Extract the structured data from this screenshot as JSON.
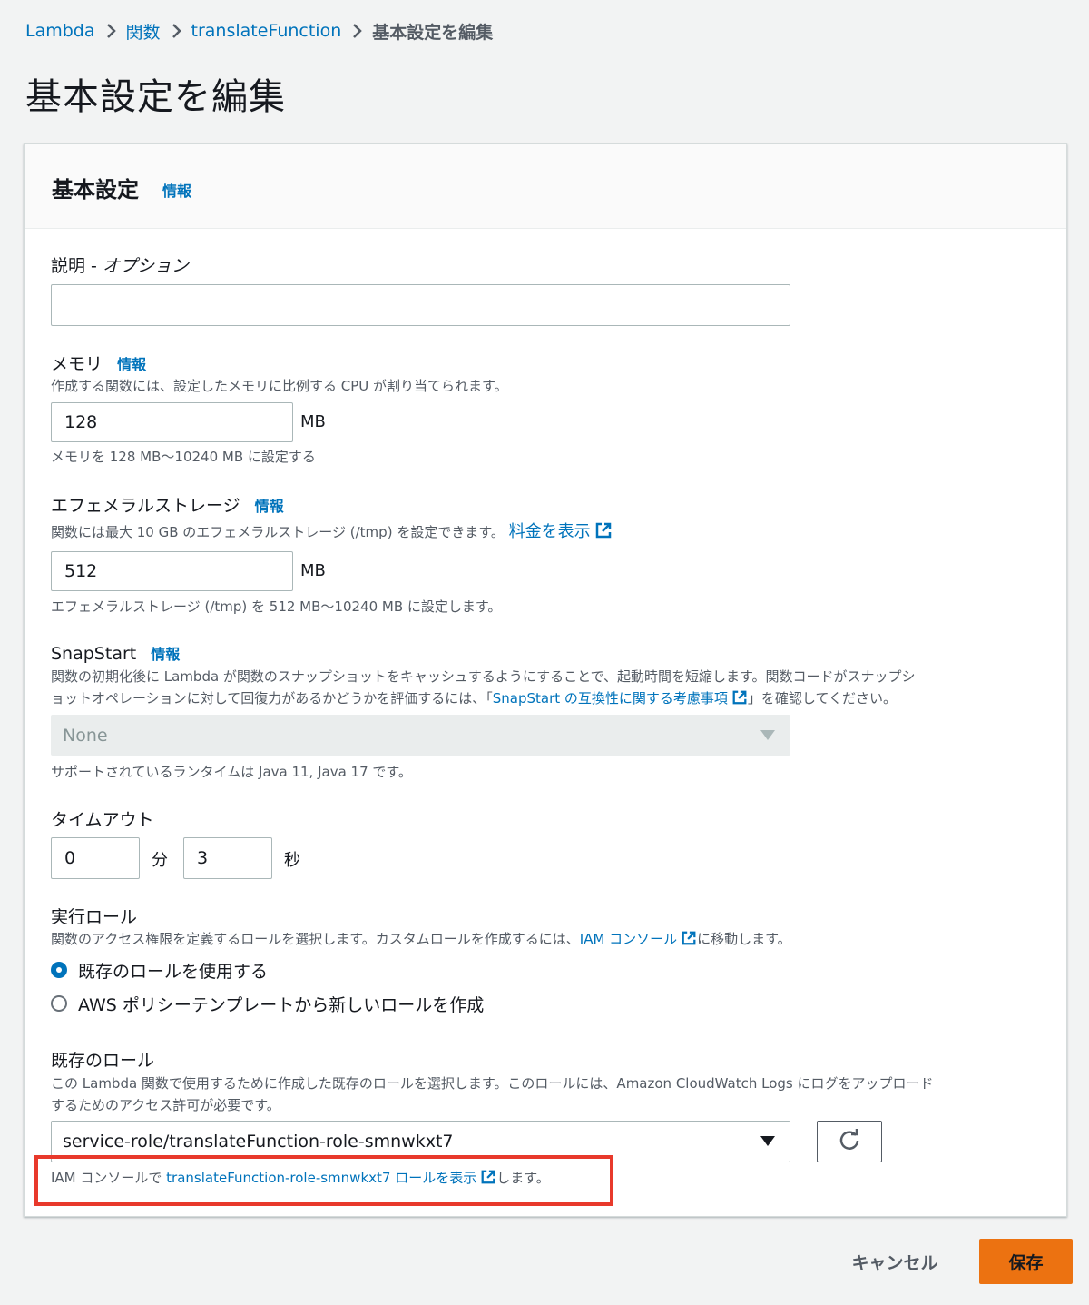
{
  "breadcrumb": {
    "items": [
      "Lambda",
      "関数",
      "translateFunction"
    ],
    "current": "基本設定を編集"
  },
  "page_title": "基本設定を編集",
  "panel": {
    "title": "基本設定",
    "info": "情報"
  },
  "description_field": {
    "label": "説明 - ",
    "label_optional": "オプション",
    "value": ""
  },
  "memory": {
    "label": "メモリ",
    "info": "情報",
    "description": "作成する関数には、設定したメモリに比例する CPU が割り当てられます。",
    "value": "128",
    "unit": "MB",
    "hint": "メモリを 128 MB〜10240 MB に設定する"
  },
  "ephemeral_storage": {
    "label": "エフェメラルストレージ",
    "info": "情報",
    "description": "関数には最大 10 GB のエフェメラルストレージ (/tmp) を設定できます。",
    "pricing_link": "料金を表示",
    "value": "512",
    "unit": "MB",
    "hint": "エフェメラルストレージ (/tmp) を 512 MB〜10240 MB に設定します。"
  },
  "snapstart": {
    "label": "SnapStart",
    "info": "情報",
    "description_line1": "関数の初期化後に Lambda が関数のスナップショットをキャッシュするようにすることで、起動時間を短縮します。関数コードがスナップシ",
    "description_line2_pre": "ョットオペレーションに対して回復力があるかどうかを評価するには、「",
    "description_link": "SnapStart の互換性に関する考慮事項",
    "description_line2_post": "」を確認してください。",
    "selected": "None",
    "hint": "サポートされているランタイムは Java 11, Java 17 です。"
  },
  "timeout": {
    "label": "タイムアウト",
    "minutes_value": "0",
    "minutes_unit": "分",
    "seconds_value": "3",
    "seconds_unit": "秒"
  },
  "execution_role": {
    "label": "実行ロール",
    "description_pre": "関数のアクセス権限を定義するロールを選択します。カスタムロールを作成するには、",
    "description_link": "IAM コンソール",
    "description_post": "に移動します。",
    "options": [
      "既存のロールを使用する",
      "AWS ポリシーテンプレートから新しいロールを作成"
    ],
    "selected_index": 0
  },
  "existing_role": {
    "label": "既存のロール",
    "description_line1": "この Lambda 関数で使用するために作成した既存のロールを選択します。このロールには、Amazon CloudWatch Logs にログをアップロード",
    "description_line2": "するためのアクセス許可が必要です。",
    "selected": "service-role/translateFunction-role-smnwkxt7",
    "view_pre": "IAM コンソールで ",
    "view_link": "translateFunction-role-smnwkxt7 ロールを表示",
    "view_post": "します。"
  },
  "footer": {
    "cancel": "キャンセル",
    "save": "保存"
  },
  "colors": {
    "link": "#0073bb",
    "primary_button": "#ec7211",
    "highlight": "#e8392b"
  }
}
